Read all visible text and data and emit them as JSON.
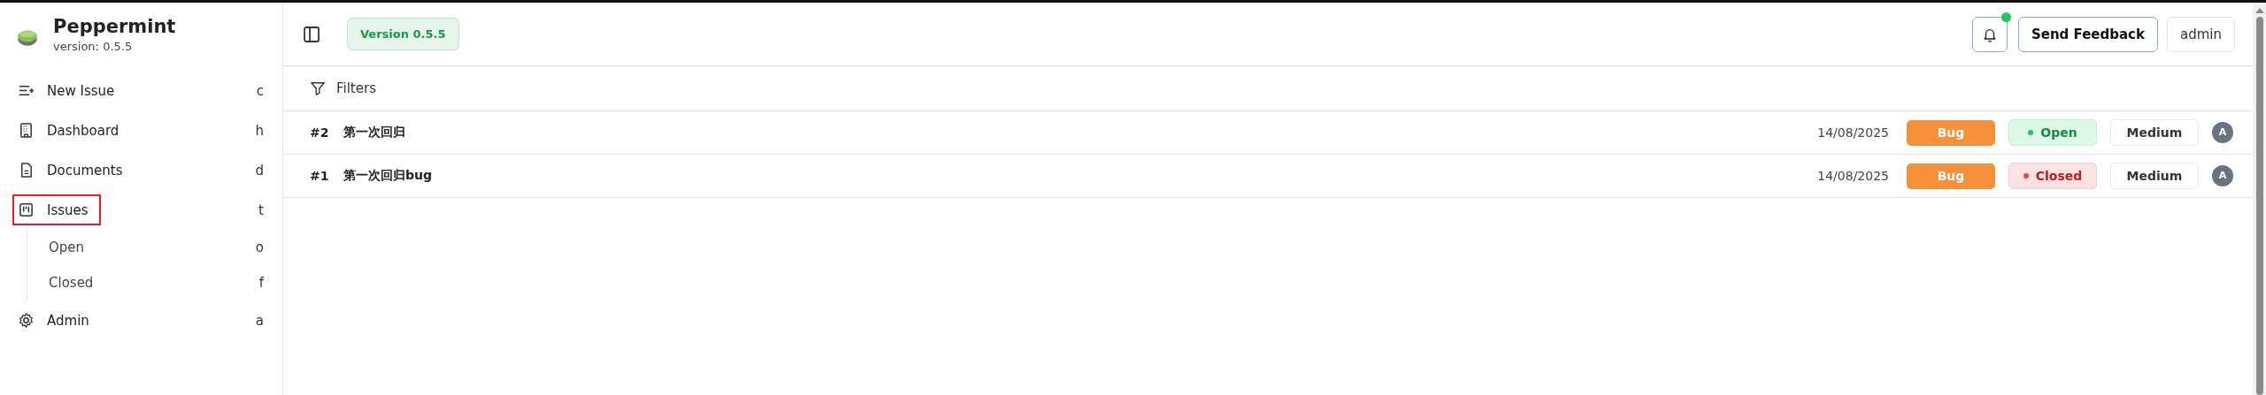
{
  "sidebar": {
    "app_name": "Peppermint",
    "version": "version: 0.5.5",
    "items": [
      {
        "label": "New Issue",
        "shortcut": "c",
        "kind": "new",
        "highlighted": false
      },
      {
        "label": "Dashboard",
        "shortcut": "h",
        "kind": "building",
        "highlighted": false
      },
      {
        "label": "Documents",
        "shortcut": "d",
        "kind": "document",
        "highlighted": false
      },
      {
        "label": "Issues",
        "shortcut": "t",
        "kind": "kanban",
        "highlighted": true,
        "children": [
          {
            "label": "Open",
            "shortcut": "o"
          },
          {
            "label": "Closed",
            "shortcut": "f"
          }
        ]
      },
      {
        "label": "Admin",
        "shortcut": "a",
        "kind": "gear",
        "highlighted": false
      }
    ]
  },
  "header": {
    "version_badge": "Version 0.5.5",
    "notification": true,
    "feedback_button": "Send Feedback",
    "user_button": "admin"
  },
  "filters": {
    "label": "Filters"
  },
  "issues": [
    {
      "number": "#2",
      "title": "第一次回归",
      "date": "14/08/2025",
      "type": "Bug",
      "status": {
        "label": "Open",
        "kind": "open"
      },
      "priority": "Medium",
      "assignee": "A"
    },
    {
      "number": "#1",
      "title": "第一次回归bug",
      "date": "14/08/2025",
      "type": "Bug",
      "status": {
        "label": "Closed",
        "kind": "closed"
      },
      "priority": "Medium",
      "assignee": "A"
    }
  ]
}
